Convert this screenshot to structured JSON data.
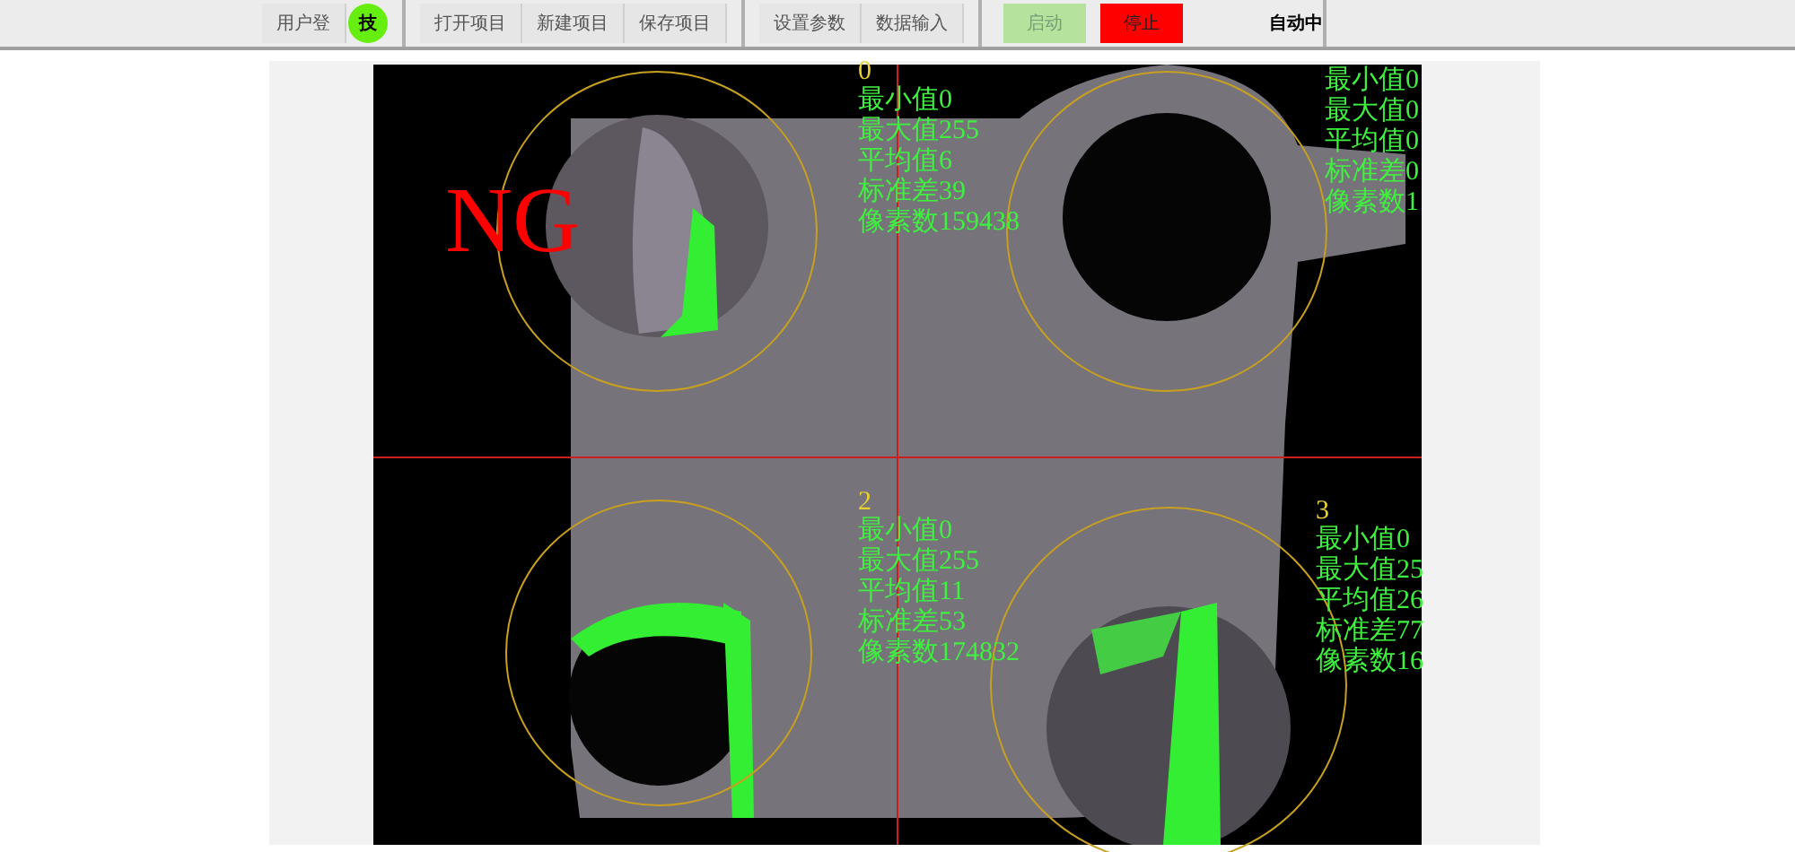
{
  "toolbar": {
    "groups": [
      [
        {
          "label": "用户登",
          "kind": "plain",
          "badge": "技"
        }
      ],
      [
        {
          "label": "打开项目",
          "kind": "plain"
        },
        {
          "label": "新建项目",
          "kind": "plain"
        },
        {
          "label": "保存项目",
          "kind": "plain"
        }
      ],
      [
        {
          "label": "设置参数",
          "kind": "plain"
        },
        {
          "label": "数据输入",
          "kind": "plain"
        }
      ],
      [
        {
          "label": "启动",
          "kind": "start",
          "disabled": true
        },
        {
          "label": "停止",
          "kind": "stop",
          "disabled": false
        }
      ]
    ],
    "status": "自动中"
  },
  "inspection": {
    "result": "NG",
    "regions": [
      {
        "index": "0",
        "stats": [
          "最小值0",
          "最大值255",
          "平均值6",
          "标准差39",
          "像素数159438"
        ]
      },
      {
        "stats": [
          "最小值0",
          "最大值0",
          "平均值0",
          "标准差0",
          "像素数1"
        ]
      },
      {
        "index": "2",
        "stats": [
          "最小值0",
          "最大值255",
          "平均值11",
          "标准差53",
          "像素数174832"
        ]
      },
      {
        "index": "3",
        "stats": [
          "最小值0",
          "最大值25",
          "平均值26",
          "标准差77",
          "像素数16"
        ]
      }
    ]
  }
}
